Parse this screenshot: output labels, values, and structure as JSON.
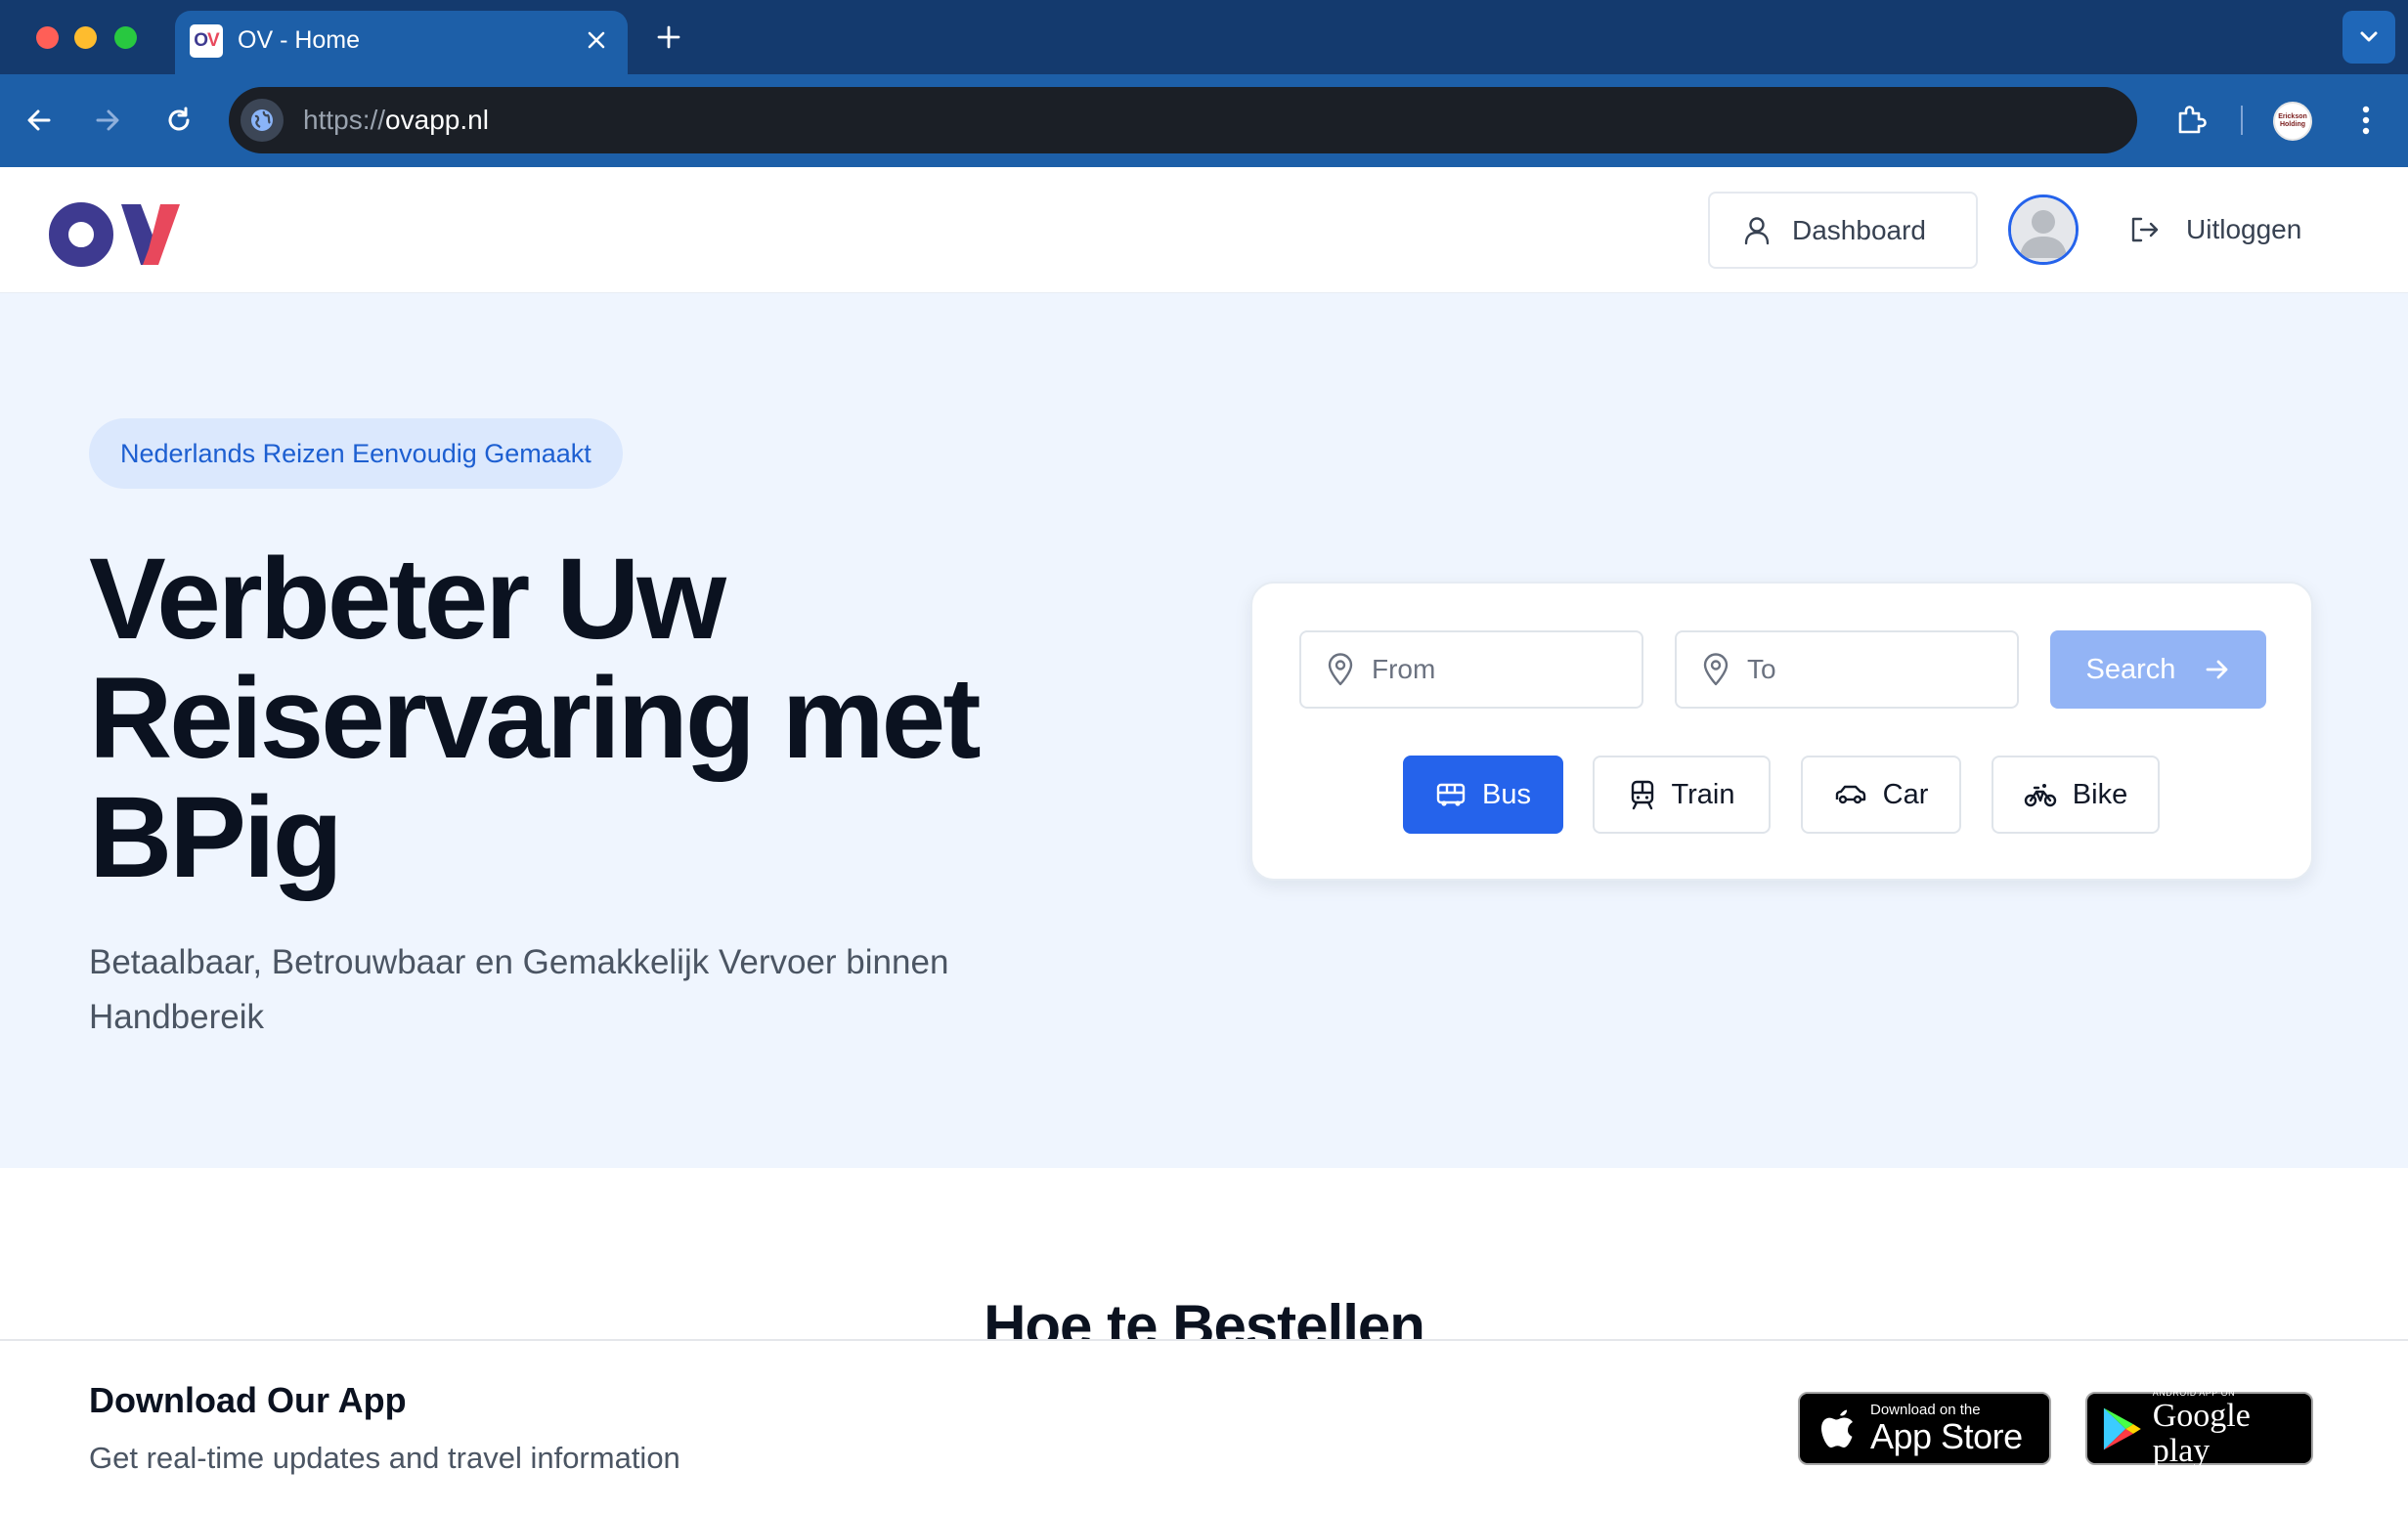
{
  "browser": {
    "tab_title": "OV - Home",
    "favicon_text_o": "O",
    "favicon_text_v": "V",
    "url_scheme": "https://",
    "url_host": "ovapp.nl",
    "profile_text": "Erickson Holding"
  },
  "header": {
    "logo_text": "OV",
    "dashboard_label": "Dashboard",
    "logout_label": "Uitloggen"
  },
  "hero": {
    "badge": "Nederlands Reizen Eenvoudig Gemaakt",
    "title": "Verbeter Uw Reiservaring met BPig",
    "subtitle": "Betaalbaar, Betrouwbaar en Gemakkelijk Vervoer binnen Handbereik"
  },
  "search": {
    "from_placeholder": "From",
    "to_placeholder": "To",
    "button_label": "Search",
    "modes": [
      {
        "label": "Bus",
        "selected": true
      },
      {
        "label": "Train",
        "selected": false
      },
      {
        "label": "Car",
        "selected": false
      },
      {
        "label": "Bike",
        "selected": false
      }
    ]
  },
  "section": {
    "title": "Hoe te Bestellen"
  },
  "app_banner": {
    "title": "Download Our App",
    "subtitle": "Get real-time updates and travel information",
    "appstore_small": "Download on the",
    "appstore_big": "App Store",
    "googleplay_small": "ANDROID APP ON",
    "googleplay_big": "Google play"
  },
  "colors": {
    "primary": "#2563eb",
    "brand_purple": "#3e3a90",
    "brand_red": "#e8485c",
    "hero_bg": "#eff5fe"
  }
}
